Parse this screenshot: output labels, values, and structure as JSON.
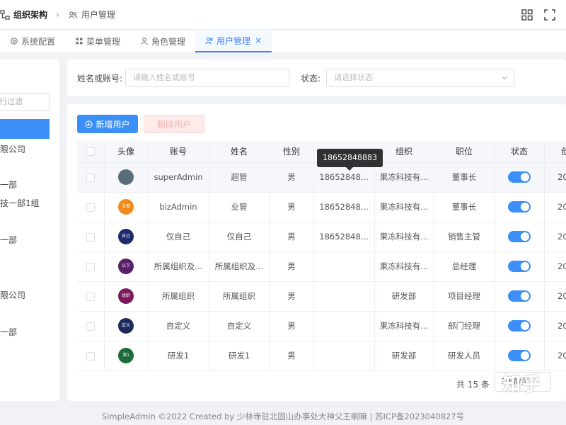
{
  "colors": {
    "accent": "#3b8ff6",
    "danger_light": "#fdeaea"
  },
  "breadcrumb": {
    "first": "组织架构",
    "second": "用户管理"
  },
  "topbar_icons": [
    "layout-grid-icon",
    "fullscreen-icon"
  ],
  "tabs": [
    {
      "label": "系统配置",
      "icon": "settings-icon"
    },
    {
      "label": "菜单管理",
      "icon": "menu-grid-icon"
    },
    {
      "label": "角色管理",
      "icon": "user-icon"
    },
    {
      "label": "用户管理",
      "icon": "users-icon",
      "active": true
    }
  ],
  "tree": {
    "search_placeholder": "行过滤",
    "items": [
      "限公司",
      "一部",
      "技一部1组",
      "一部",
      "限公司",
      "一部"
    ]
  },
  "filter": {
    "name_label": "姓名或账号:",
    "name_placeholder": "请输入姓名或账号",
    "status_label": "状态:",
    "status_placeholder": "请选择状态"
  },
  "toolbar": {
    "add_label": "新增用户",
    "delete_label": "删除用户"
  },
  "table": {
    "headers": [
      "",
      "头像",
      "账号",
      "姓名",
      "性别",
      "",
      "组织",
      "职位",
      "状态",
      "创"
    ],
    "rows": [
      {
        "avatar_text": "",
        "avatar_color": "#5a6b7a",
        "account": "superAdmin",
        "name": "超管",
        "gender": "男",
        "phone": "18652848...",
        "org": "果冻科技有...",
        "position": "董事长",
        "year": "202"
      },
      {
        "avatar_text": "业管",
        "avatar_color": "#f08a1c",
        "account": "bizAdmin",
        "name": "业管",
        "gender": "男",
        "phone": "18652848...",
        "org": "果冻科技有...",
        "position": "董事长",
        "year": "202"
      },
      {
        "avatar_text": "自己",
        "avatar_color": "#1e2a6b",
        "account": "仅自己",
        "name": "仅自己",
        "gender": "男",
        "phone": "18652848...",
        "org": "果冻科技有...",
        "position": "销售主管",
        "year": "202"
      },
      {
        "avatar_text": "以下",
        "avatar_color": "#5a1f6b",
        "account": "所属组织及...",
        "name": "所属组织及...",
        "gender": "男",
        "phone": "",
        "org": "果冻科技有...",
        "position": "总经理",
        "year": "202"
      },
      {
        "avatar_text": "组织",
        "avatar_color": "#7a1a5a",
        "account": "所属组织",
        "name": "所属组织",
        "gender": "男",
        "phone": "",
        "org": "研发部",
        "position": "项目经理",
        "year": "202"
      },
      {
        "avatar_text": "定义",
        "avatar_color": "#1e2a5b",
        "account": "自定义",
        "name": "自定义",
        "gender": "男",
        "phone": "",
        "org": "果冻科技有...",
        "position": "部门经理",
        "year": "202"
      },
      {
        "avatar_text": "发1",
        "avatar_color": "#1e6b3a",
        "account": "研发1",
        "name": "研发1",
        "gender": "男",
        "phone": "",
        "org": "研发部",
        "position": "研发人员",
        "year": "202"
      }
    ]
  },
  "tooltip": "18652848883",
  "pagination": {
    "total": "共 15 条",
    "page_size": "10条/页"
  },
  "watermark": "知乎",
  "footer": "SimpleAdmin ©2022 Created by 少林寺驻北固山办事处大神父王喇嘛 | 苏ICP备2023040827号"
}
